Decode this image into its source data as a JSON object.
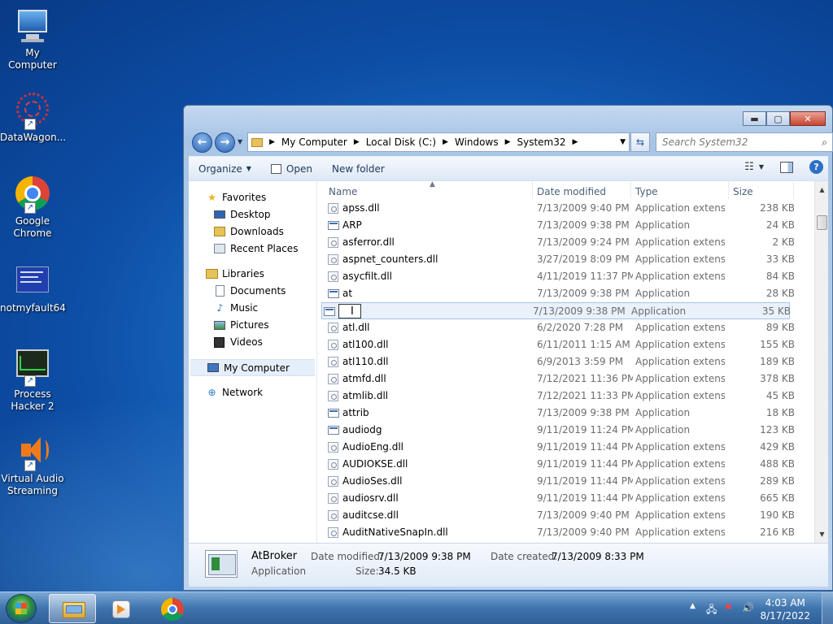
{
  "desktop": {
    "icons": [
      {
        "label": "My Computer"
      },
      {
        "label": "DataWagon..."
      },
      {
        "label": "Google Chrome"
      },
      {
        "label": "notmyfault64"
      },
      {
        "label": "Process Hacker 2"
      },
      {
        "label": "Virtual Audio Streaming"
      }
    ]
  },
  "window": {
    "caption": {
      "minimize": "▬",
      "maximize": "▢",
      "close": "✕"
    },
    "address": {
      "crumbs": [
        "My Computer",
        "Local Disk (C:)",
        "Windows",
        "System32"
      ],
      "separator": "▶"
    },
    "search_placeholder": "Search System32",
    "toolbar": {
      "organize": "Organize",
      "open": "Open",
      "new_folder": "New folder"
    },
    "nav_pane": {
      "favorites": "Favorites",
      "desktop": "Desktop",
      "downloads": "Downloads",
      "recent_places": "Recent Places",
      "libraries": "Libraries",
      "documents": "Documents",
      "music": "Music",
      "pictures": "Pictures",
      "videos": "Videos",
      "my_computer": "My Computer",
      "network": "Network"
    },
    "columns": {
      "name": "Name",
      "date": "Date modified",
      "type": "Type",
      "size": "Size"
    },
    "files": [
      {
        "name": "apss.dll",
        "date": "7/13/2009 9:40 PM",
        "type": "Application extens...",
        "size": "238 KB",
        "kind": "dll"
      },
      {
        "name": "ARP",
        "date": "7/13/2009 9:38 PM",
        "type": "Application",
        "size": "24 KB",
        "kind": "app"
      },
      {
        "name": "asferror.dll",
        "date": "7/13/2009 9:24 PM",
        "type": "Application extens...",
        "size": "2 KB",
        "kind": "dll"
      },
      {
        "name": "aspnet_counters.dll",
        "date": "3/27/2019 8:09 PM",
        "type": "Application extens...",
        "size": "33 KB",
        "kind": "dll"
      },
      {
        "name": "asycfilt.dll",
        "date": "4/11/2019 11:37 PM",
        "type": "Application extens...",
        "size": "84 KB",
        "kind": "dll"
      },
      {
        "name": "at",
        "date": "7/13/2009 9:38 PM",
        "type": "Application",
        "size": "28 KB",
        "kind": "app"
      },
      {
        "name": "",
        "date": "7/13/2009 9:38 PM",
        "type": "Application",
        "size": "35 KB",
        "kind": "app",
        "editing": true
      },
      {
        "name": "atl.dll",
        "date": "6/2/2020 7:28 PM",
        "type": "Application extens...",
        "size": "89 KB",
        "kind": "dll"
      },
      {
        "name": "atl100.dll",
        "date": "6/11/2011 1:15 AM",
        "type": "Application extens...",
        "size": "155 KB",
        "kind": "dll"
      },
      {
        "name": "atl110.dll",
        "date": "6/9/2013 3:59 PM",
        "type": "Application extens...",
        "size": "189 KB",
        "kind": "dll"
      },
      {
        "name": "atmfd.dll",
        "date": "7/12/2021 11:36 PM",
        "type": "Application extens...",
        "size": "378 KB",
        "kind": "dll"
      },
      {
        "name": "atmlib.dll",
        "date": "7/12/2021 11:33 PM",
        "type": "Application extens...",
        "size": "45 KB",
        "kind": "dll"
      },
      {
        "name": "attrib",
        "date": "7/13/2009 9:38 PM",
        "type": "Application",
        "size": "18 KB",
        "kind": "app"
      },
      {
        "name": "audiodg",
        "date": "9/11/2019 11:24 PM",
        "type": "Application",
        "size": "123 KB",
        "kind": "app"
      },
      {
        "name": "AudioEng.dll",
        "date": "9/11/2019 11:44 PM",
        "type": "Application extens...",
        "size": "429 KB",
        "kind": "dll"
      },
      {
        "name": "AUDIOKSE.dll",
        "date": "9/11/2019 11:44 PM",
        "type": "Application extens...",
        "size": "488 KB",
        "kind": "dll"
      },
      {
        "name": "AudioSes.dll",
        "date": "9/11/2019 11:44 PM",
        "type": "Application extens...",
        "size": "289 KB",
        "kind": "dll"
      },
      {
        "name": "audiosrv.dll",
        "date": "9/11/2019 11:44 PM",
        "type": "Application extens...",
        "size": "665 KB",
        "kind": "dll"
      },
      {
        "name": "auditcse.dll",
        "date": "7/13/2009 9:40 PM",
        "type": "Application extens...",
        "size": "190 KB",
        "kind": "dll"
      },
      {
        "name": "AuditNativeSnapIn.dll",
        "date": "7/13/2009 9:40 PM",
        "type": "Application extens...",
        "size": "216 KB",
        "kind": "dll"
      }
    ],
    "details": {
      "name": "AtBroker",
      "type": "Application",
      "date_modified_label": "Date modified:",
      "date_modified": "7/13/2009 9:38 PM",
      "size_label": "Size:",
      "size": "34.5 KB",
      "date_created_label": "Date created:",
      "date_created": "7/13/2009 8:33 PM"
    }
  },
  "taskbar": {
    "clock_time": "4:03 AM",
    "clock_date": "8/17/2022",
    "tray_chevron": "▲"
  },
  "colors": {
    "accent": "#1d6fc7",
    "selection": "#e9f1fb"
  }
}
